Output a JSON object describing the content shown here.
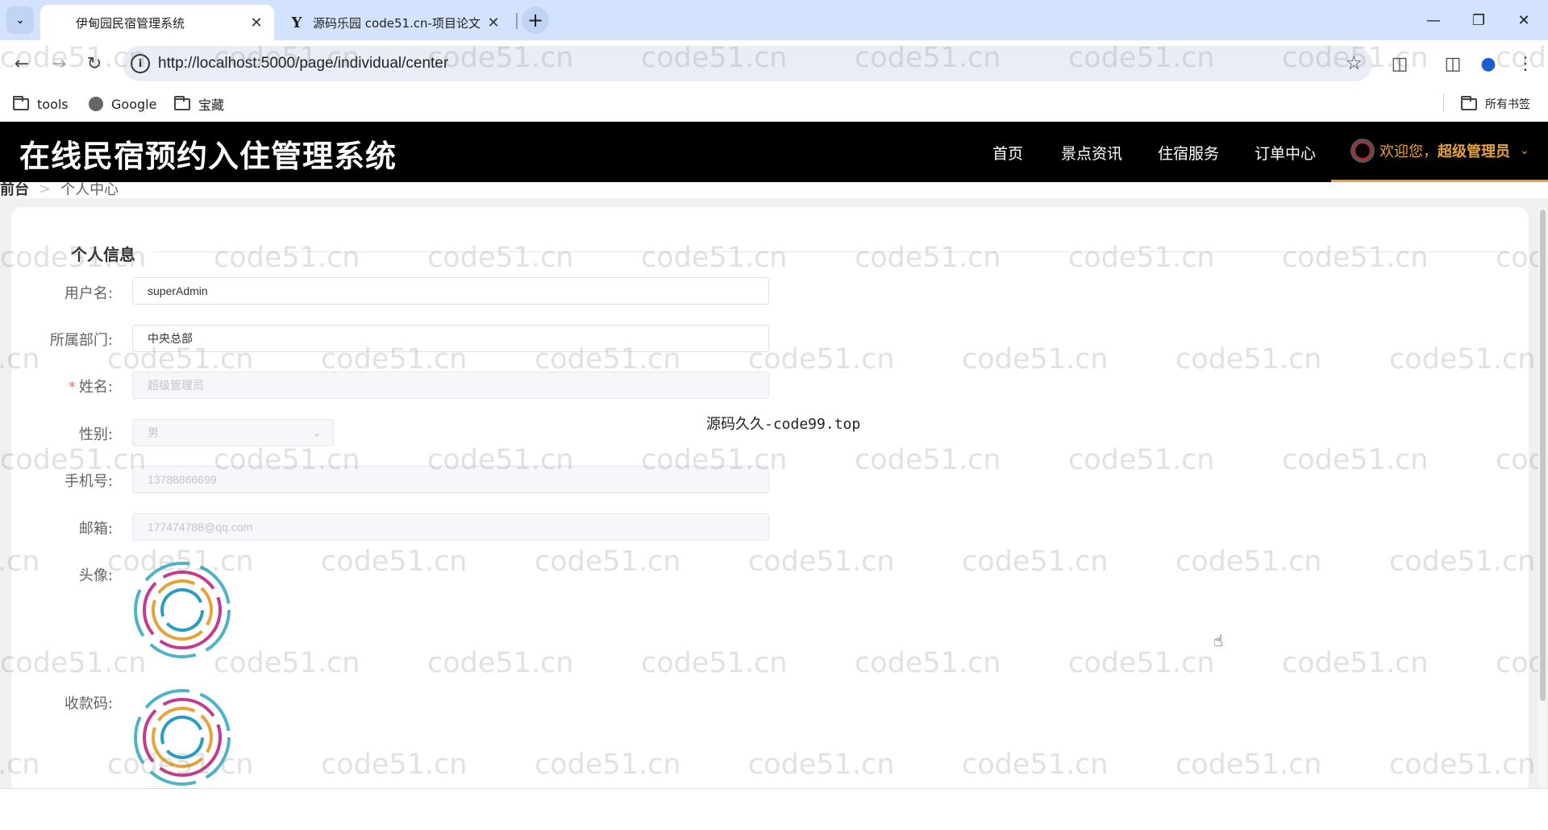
{
  "browser": {
    "tabs": [
      {
        "title": "伊甸园民宿管理系统",
        "active": true
      },
      {
        "title": "源码乐园 code51.cn-项目论文",
        "active": false
      }
    ],
    "address": {
      "url": "http://localhost:5000/page/individual/center"
    },
    "bookmarks": [
      {
        "label": "tools",
        "icon": "folder-icon"
      },
      {
        "label": "Google",
        "icon": "globe-icon"
      },
      {
        "label": "宝藏",
        "icon": "folder-icon"
      }
    ],
    "all_bookmarks_label": "所有书签"
  },
  "site": {
    "title": "在线民宿预约入住管理系统",
    "nav": [
      "首页",
      "景点资讯",
      "住宿服务",
      "订单中心"
    ],
    "user": {
      "welcome": "欢迎您，",
      "name": "超级管理员"
    },
    "accent": "#e6a23c"
  },
  "breadcrumb": {
    "home": "前台",
    "current": "个人中心"
  },
  "profile": {
    "section_title": "个人信息",
    "fields": {
      "username": {
        "label": "用户名:",
        "value": "superAdmin"
      },
      "department": {
        "label": "所属部门:",
        "value": "中央总部"
      },
      "name": {
        "label": "姓名:",
        "value": "超级管理员",
        "required_mark": "*"
      },
      "gender": {
        "label": "性别:",
        "value": "男"
      },
      "phone": {
        "label": "手机号:",
        "value": "13788866699"
      },
      "email": {
        "label": "邮箱:",
        "value": "177474788@qq.com"
      },
      "avatar": {
        "label": "头像:"
      },
      "payment_code": {
        "label": "收款码:"
      }
    }
  },
  "overlay": "源码久久-code99.top",
  "watermark": "code51.cn"
}
